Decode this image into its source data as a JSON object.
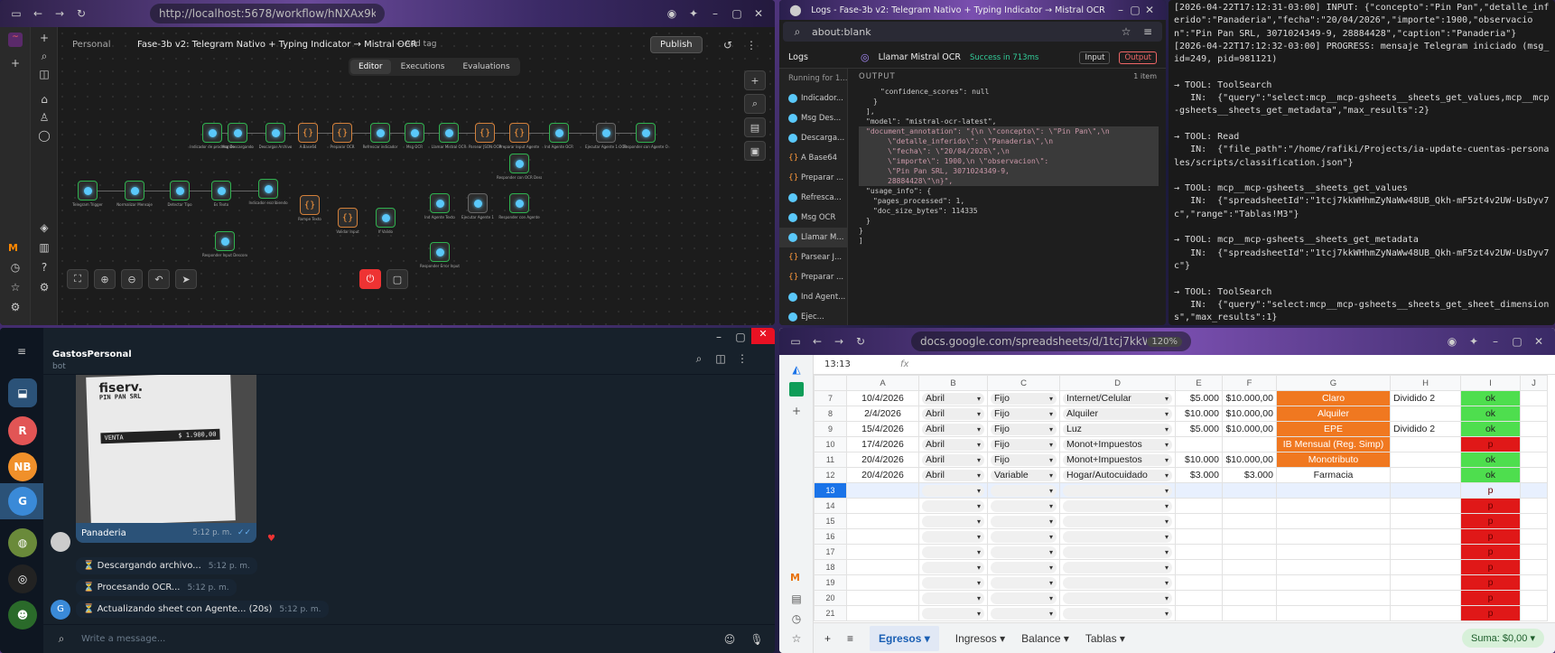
{
  "n8n": {
    "url": "http://localhost:5678/workflow/hNXAx9k73TycEaR",
    "breadcrumb_root": "Personal",
    "workflow_title": "Fase-3b v2: Telegram Nativo + Typing Indicator → Mistral OCR",
    "add_tag": "+ Add tag",
    "publish": "Publish",
    "tabs": [
      "Editor",
      "Executions",
      "Evaluations"
    ],
    "nodes_top": [
      "Indicador de procesando",
      "Msg Descargando",
      "Descargar Archivo",
      "A Base64",
      "Preparar OCR",
      "Refrescar indicador",
      "Msg OCR",
      "Llamar Mistral OCR",
      "Parsear JSON OCR",
      "Preparar Input Agente",
      "Ind Agente OCR",
      "Ejecutar Agente 1 OCR",
      "Responder con Agente OCR"
    ],
    "nodes_bottom": [
      "Telegram Trigger",
      "Normalizar Mensaje",
      "Detectar Tipo",
      "Es Texto",
      "Indicador escribiendo",
      "Rompe Texto",
      "Validar Input",
      "If Valido",
      "Ind Agente Texto",
      "Ejecutar Agente 1",
      "Responder con Agente",
      "Responder Input Desconocido",
      "Responder Error Input",
      "Responder con OCR Desconocido"
    ]
  },
  "logs": {
    "window_title": "Logs - Fase-3b v2: Telegram Nativo + Typing Indicator → Mistral OCR",
    "url": "about:blank",
    "header": "Logs",
    "node_title": "Llamar Mistral OCR",
    "status": "Success in 713ms",
    "input_tab": "Input",
    "output_tab": "Output",
    "running": "Running for 1...",
    "output_label": "OUTPUT",
    "count": "1 item",
    "items": [
      "Indicador...",
      "Msg Des...",
      "Descarga...",
      "A Base64",
      "Preparar ...",
      "Refresca...",
      "Msg OCR",
      "Llamar M...",
      "Parsear J...",
      "Preparar ...",
      "Ind Agent...",
      "Ejec..."
    ],
    "code": [
      "\"confidence_scores\": null",
      "}",
      "],",
      "\"model\": \"mistral-ocr-latest\",",
      "\"document_annotation\": \"{\\n  \\\"concepto\\\": \\\"Pin Pan\\\",\\n",
      "\\\"detalle_inferido\\\": \\\"Panaderia\\\",\\n",
      "\\\"fecha\\\": \\\"20/04/2026\\\",\\n",
      "\\\"importe\\\": 1900,\\n  \\\"observacion\\\":",
      "\\\"Pin Pan SRL, 3071024349-9,",
      "28884428\\\"\\n}\",",
      "\"usage_info\": {",
      "\"pages_processed\": 1,",
      "\"doc_size_bytes\": 114335",
      "}",
      "}",
      "]"
    ]
  },
  "terminal": {
    "lines": [
      "[2026-04-22T17:12:31-03:00] INPUT: {\"concepto\":\"Pin Pan\",\"detalle_inferido\":\"Panaderia\",\"fecha\":\"20/04/2026\",\"importe\":1900,\"observacion\":\"Pin Pan SRL, 3071024349-9, 28884428\",\"caption\":\"Panaderia\"}",
      "[2026-04-22T17:12:32-03:00] PROGRESS: mensaje Telegram iniciado (msg_id=249, pid=981121)",
      "",
      "→ TOOL: ToolSearch",
      "   IN:  {\"query\":\"select:mcp__mcp-gsheets__sheets_get_values,mcp__mcp-gsheets__sheets_get_metadata\",\"max_results\":2}",
      "",
      "→ TOOL: Read",
      "   IN:  {\"file_path\":\"/home/rafiki/Projects/ia-update-cuentas-personales/scripts/classification.json\"}",
      "",
      "→ TOOL: mcp__mcp-gsheets__sheets_get_values",
      "   IN:  {\"spreadsheetId\":\"1tcj7kkWHhmZyNaWw48UB_Qkh-mF5zt4v2UW-UsDyv7c\",\"range\":\"Tablas!M3\"}",
      "",
      "→ TOOL: mcp__mcp-gsheets__sheets_get_metadata",
      "   IN:  {\"spreadsheetId\":\"1tcj7kkWHhmZyNaWw48UB_Qkh-mF5zt4v2UW-UsDyv7c\"}",
      "",
      "→ TOOL: ToolSearch",
      "   IN:  {\"query\":\"select:mcp__mcp-gsheets__sheets_get_sheet_dimensions\",\"max_results\":1}",
      "▯"
    ]
  },
  "telegram": {
    "chat_title": "GastosPersonal",
    "chat_subtitle": "bot",
    "avatars": [
      "R",
      "NB",
      "G"
    ],
    "caption": "Panaderia",
    "caption_time": "5:12 p. m.",
    "messages": [
      {
        "text": "⏳ Descargando archivo...",
        "time": "5:12 p. m."
      },
      {
        "text": "⏳ Procesando OCR...",
        "time": "5:12 p. m."
      },
      {
        "text": "⏳ Actualizando sheet con Agente... (20s)",
        "time": "5:12 p. m."
      }
    ],
    "placeholder": "Write a message...",
    "receipt": {
      "brand": "fiserv.",
      "shop": "PIN PAN SRL",
      "amount": "$ 1.900,00",
      "sale": "VENTA"
    }
  },
  "sheets": {
    "url": "docs.google.com/spreadsheets/d/1tcj7kkWHhmZyNaWw48UB...",
    "zoom": "120%",
    "cell_ref": "13:13",
    "fx": "fx",
    "cols": [
      "A",
      "B",
      "C",
      "D",
      "E",
      "F",
      "G",
      "H",
      "I",
      "J"
    ],
    "rows": [
      {
        "n": "7",
        "a": "10/4/2026",
        "b": "Abril",
        "c": "Fijo",
        "d": "Internet/Celular",
        "e": "$5.000",
        "f": "$10.000,00",
        "g": "Claro",
        "h": "Dividido 2",
        "i": "ok",
        "gcls": "or",
        "icls": "ok"
      },
      {
        "n": "8",
        "a": "2/4/2026",
        "b": "Abril",
        "c": "Fijo",
        "d": "Alquiler",
        "e": "$10.000",
        "f": "$10.000,00",
        "g": "Alquiler",
        "h": "",
        "i": "ok",
        "gcls": "or",
        "icls": "ok"
      },
      {
        "n": "9",
        "a": "15/4/2026",
        "b": "Abril",
        "c": "Fijo",
        "d": "Luz",
        "e": "$5.000",
        "f": "$10.000,00",
        "g": "EPE",
        "h": "Dividido 2",
        "i": "ok",
        "gcls": "or",
        "icls": "ok"
      },
      {
        "n": "10",
        "a": "17/4/2026",
        "b": "Abril",
        "c": "Fijo",
        "d": "Monot+Impuestos",
        "e": "",
        "f": "",
        "g": "IB Mensual (Reg. Simp)",
        "h": "",
        "i": "p",
        "gcls": "or",
        "icls": "bad"
      },
      {
        "n": "11",
        "a": "20/4/2026",
        "b": "Abril",
        "c": "Fijo",
        "d": "Monot+Impuestos",
        "e": "$10.000",
        "f": "$10.000,00",
        "g": "Monotributo",
        "h": "",
        "i": "ok",
        "gcls": "or",
        "icls": "ok"
      },
      {
        "n": "12",
        "a": "20/4/2026",
        "b": "Abril",
        "c": "Variable",
        "d": "Hogar/Autocuidado",
        "e": "$3.000",
        "f": "$3.000",
        "g": "Farmacia",
        "h": "",
        "i": "ok",
        "gcls": "c",
        "icls": "ok"
      }
    ],
    "empty_rows": [
      "13",
      "14",
      "15",
      "16",
      "17",
      "18",
      "19",
      "20",
      "21"
    ],
    "tabs": [
      "Egresos",
      "Ingresos",
      "Balance",
      "Tablas"
    ],
    "sum": "Suma: $0,00"
  }
}
